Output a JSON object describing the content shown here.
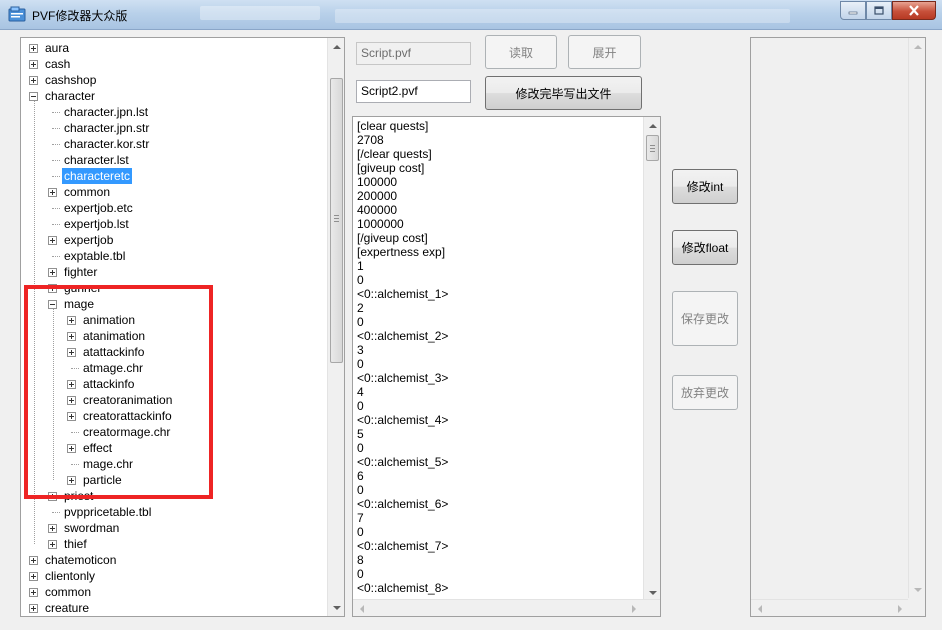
{
  "window": {
    "title": "PVF修改器大众版"
  },
  "tree": {
    "rows": [
      {
        "label": "aura",
        "level": 0,
        "expander": "plus"
      },
      {
        "label": "cash",
        "level": 0,
        "expander": "plus"
      },
      {
        "label": "cashshop",
        "level": 0,
        "expander": "plus"
      },
      {
        "label": "character",
        "level": 0,
        "expander": "minus"
      },
      {
        "label": "character.jpn.lst",
        "level": 1,
        "expander": "none"
      },
      {
        "label": "character.jpn.str",
        "level": 1,
        "expander": "none"
      },
      {
        "label": "character.kor.str",
        "level": 1,
        "expander": "none"
      },
      {
        "label": "character.lst",
        "level": 1,
        "expander": "none"
      },
      {
        "label": "characteretc",
        "level": 1,
        "expander": "none",
        "selected": true
      },
      {
        "label": "common",
        "level": 1,
        "expander": "plus"
      },
      {
        "label": "expertjob.etc",
        "level": 1,
        "expander": "none"
      },
      {
        "label": "expertjob.lst",
        "level": 1,
        "expander": "none"
      },
      {
        "label": "expertjob",
        "level": 1,
        "expander": "plus"
      },
      {
        "label": "exptable.tbl",
        "level": 1,
        "expander": "none"
      },
      {
        "label": "fighter",
        "level": 1,
        "expander": "plus"
      },
      {
        "label": "gunner",
        "level": 1,
        "expander": "plus"
      },
      {
        "label": "mage",
        "level": 1,
        "expander": "minus"
      },
      {
        "label": "animation",
        "level": 2,
        "expander": "plus"
      },
      {
        "label": "atanimation",
        "level": 2,
        "expander": "plus"
      },
      {
        "label": "atattackinfo",
        "level": 2,
        "expander": "plus"
      },
      {
        "label": "atmage.chr",
        "level": 2,
        "expander": "none"
      },
      {
        "label": "attackinfo",
        "level": 2,
        "expander": "plus"
      },
      {
        "label": "creatoranimation",
        "level": 2,
        "expander": "plus"
      },
      {
        "label": "creatorattackinfo",
        "level": 2,
        "expander": "plus"
      },
      {
        "label": "creatormage.chr",
        "level": 2,
        "expander": "none"
      },
      {
        "label": "effect",
        "level": 2,
        "expander": "plus"
      },
      {
        "label": "mage.chr",
        "level": 2,
        "expander": "none"
      },
      {
        "label": "particle",
        "level": 2,
        "expander": "plus"
      },
      {
        "label": "priest",
        "level": 1,
        "expander": "plus"
      },
      {
        "label": "pvppricetable.tbl",
        "level": 1,
        "expander": "none"
      },
      {
        "label": "swordman",
        "level": 1,
        "expander": "plus"
      },
      {
        "label": "thief",
        "level": 1,
        "expander": "plus"
      },
      {
        "label": "chatemoticon",
        "level": 0,
        "expander": "plus"
      },
      {
        "label": "clientonly",
        "level": 0,
        "expander": "plus"
      },
      {
        "label": "common",
        "level": 0,
        "expander": "plus"
      },
      {
        "label": "creature",
        "level": 0,
        "expander": "plus"
      }
    ]
  },
  "fields": {
    "source_file": "Script.pvf",
    "output_file": "Script2.pvf"
  },
  "buttons": {
    "read": "读取",
    "expand": "展开",
    "write_out": "修改完毕写出文件",
    "modify_int": "修改int",
    "modify_float": "修改float",
    "save_changes": "保存更改",
    "discard_changes": "放弃更改"
  },
  "text_content": [
    "[clear quests]",
    "2708",
    "[/clear quests]",
    "[giveup cost]",
    "100000",
    "200000",
    "400000",
    "1000000",
    "[/giveup cost]",
    "[expertness exp]",
    "1",
    "0",
    "<0::alchemist_1>",
    "2",
    "0",
    "<0::alchemist_2>",
    "3",
    "0",
    "<0::alchemist_3>",
    "4",
    "0",
    "<0::alchemist_4>",
    "5",
    "0",
    "<0::alchemist_5>",
    "6",
    "0",
    "<0::alchemist_6>",
    "7",
    "0",
    "<0::alchemist_7>",
    "8",
    "0",
    "<0::alchemist_8>"
  ],
  "colors": {
    "selection": "#3399ff",
    "highlight_box": "#ee2424"
  }
}
